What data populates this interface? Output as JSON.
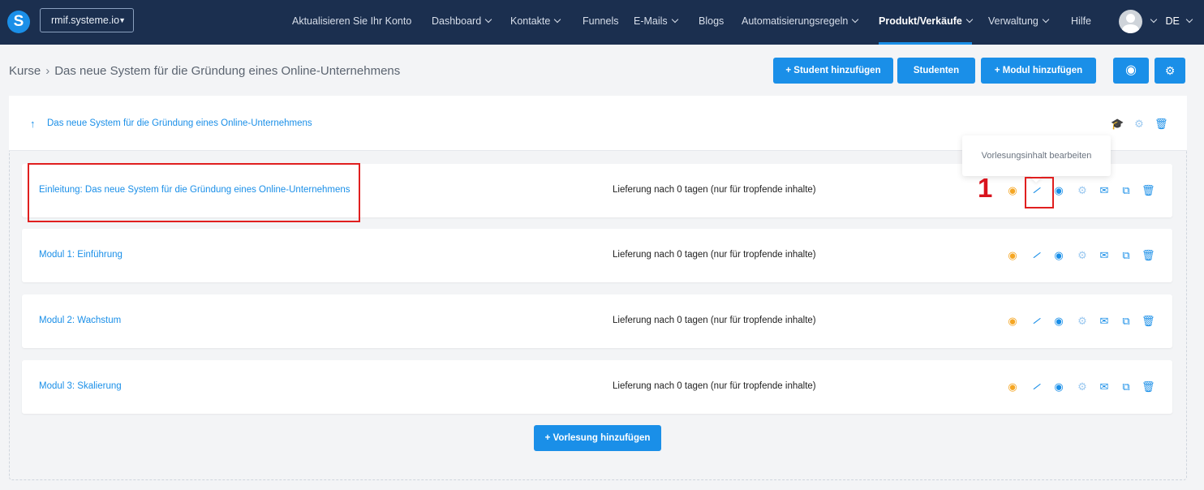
{
  "nav": {
    "logo": "S",
    "site": "rmif.systeme.io",
    "items": [
      {
        "label": "Aktualisieren Sie Ihr Konto",
        "chevron": false
      },
      {
        "label": "Dashboard",
        "chevron": true
      },
      {
        "label": "Kontakte",
        "chevron": true
      },
      {
        "label": "Funnels",
        "chevron": false
      },
      {
        "label": "E-Mails",
        "chevron": true
      },
      {
        "label": "Blogs",
        "chevron": false
      },
      {
        "label": "Automatisierungsregeln",
        "chevron": true
      },
      {
        "label": "Produkt/Verkäufe",
        "chevron": true,
        "active": true
      },
      {
        "label": "Verwaltung",
        "chevron": true
      },
      {
        "label": "Hilfe",
        "chevron": false
      }
    ],
    "language": "DE"
  },
  "breadcrumb": {
    "root": "Kurse",
    "current": "Das neue System für die Gründung eines Online-Unternehmens"
  },
  "header_buttons": {
    "add_student": "+ Student hinzufügen",
    "students": "Studenten",
    "add_module": "+ Modul hinzufügen"
  },
  "course": {
    "title": "Das neue System für die Gründung eines Online-Unternehmens"
  },
  "tooltip": "Vorlesungsinhalt bearbeiten",
  "step_label": "1",
  "lectures": [
    {
      "name": "Einleitung: Das neue System für die Gründung eines Online-Unternehmens",
      "delivery": "Lieferung nach 0 tagen (nur für tropfende inhalte)"
    },
    {
      "name": "Modul 1: Einführung",
      "delivery": "Lieferung nach 0 tagen (nur für tropfende inhalte)"
    },
    {
      "name": "Modul 2: Wachstum",
      "delivery": "Lieferung nach 0 tagen (nur für tropfende inhalte)"
    },
    {
      "name": "Modul 3: Skalierung",
      "delivery": "Lieferung nach 0 tagen (nur für tropfende inhalte)"
    }
  ],
  "add_lecture": "+ Vorlesung hinzufügen",
  "row_icons": [
    "status-icon",
    "magic-wand-edit-icon",
    "eye-icon",
    "settings-icon",
    "email-icon",
    "duplicate-icon",
    "trash-icon"
  ],
  "colors": {
    "nav_bg": "#1b2f4f",
    "accent": "#1a8fe8",
    "highlight": "#e01f1f",
    "status": "#f5a623"
  }
}
